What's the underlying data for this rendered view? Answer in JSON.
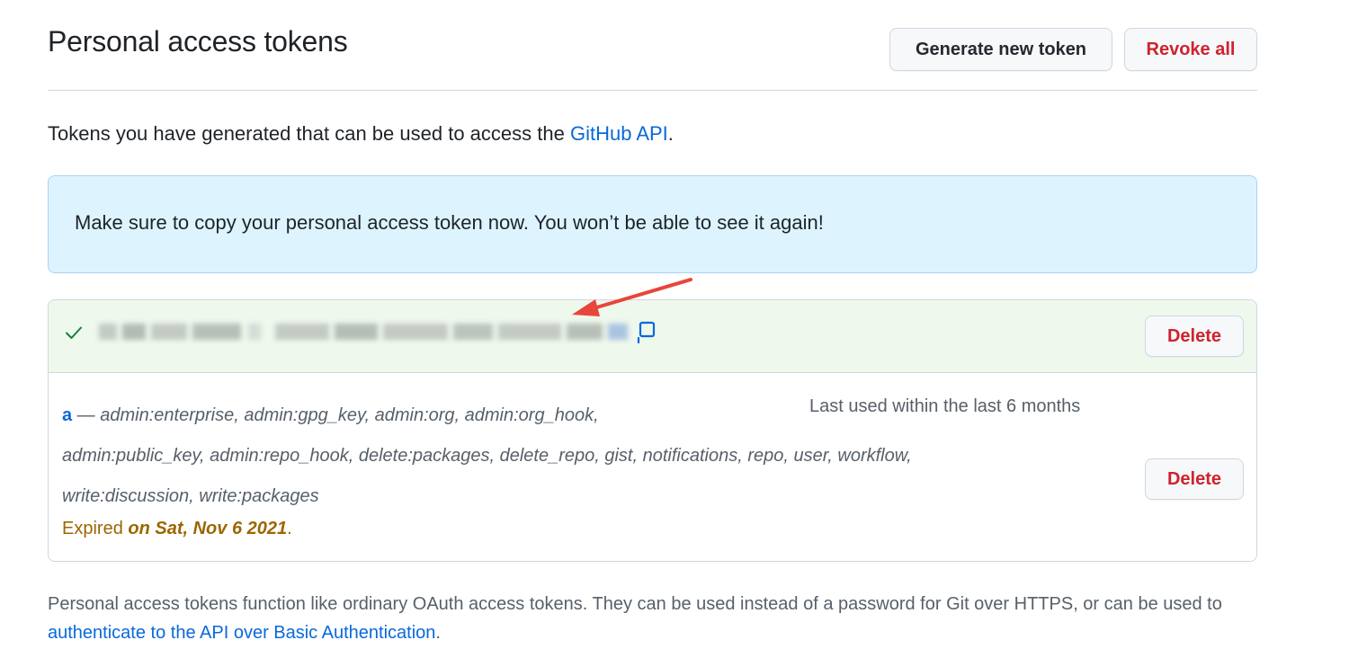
{
  "header": {
    "title": "Personal access tokens",
    "generate_label": "Generate new token",
    "revoke_label": "Revoke all"
  },
  "intro": {
    "text": "Tokens you have generated that can be used to access the ",
    "link": "GitHub API",
    "suffix": "."
  },
  "flash": {
    "message": "Make sure to copy your personal access token now. You won’t be able to see it again!"
  },
  "new_token": {
    "delete_label": "Delete"
  },
  "token": {
    "name": "a",
    "dash": " — ",
    "scopes_line1": "admin:enterprise, admin:gpg_key, admin:org, admin:org_hook,",
    "scopes_line2": "admin:public_key, admin:repo_hook, delete:packages, delete_repo, gist, notifications, repo, user, workflow,",
    "scopes_line3": "write:discussion, write:packages",
    "last_used": "Last used within the last 6 months",
    "delete_label": "Delete",
    "expired_prefix": "Expired ",
    "expired_date": "on Sat, Nov 6 2021",
    "expired_suffix": "."
  },
  "footer": {
    "text_before": "Personal access tokens function like ordinary OAuth access tokens. They can be used instead of a password for Git over HTTPS, or can be used to ",
    "link": "authenticate to the API over Basic Authentication",
    "text_after": "."
  },
  "colors": {
    "accent": "#0969da",
    "danger": "#cf222e",
    "success": "#1a7f37",
    "attention": "#9a6700",
    "flash_bg": "#ddf4ff",
    "new_token_bg": "#eef8ec",
    "annotation_arrow": "#e8453c"
  },
  "icons": {
    "check": "check-icon",
    "copy": "copy-icon",
    "annotation": "annotation-arrow"
  }
}
